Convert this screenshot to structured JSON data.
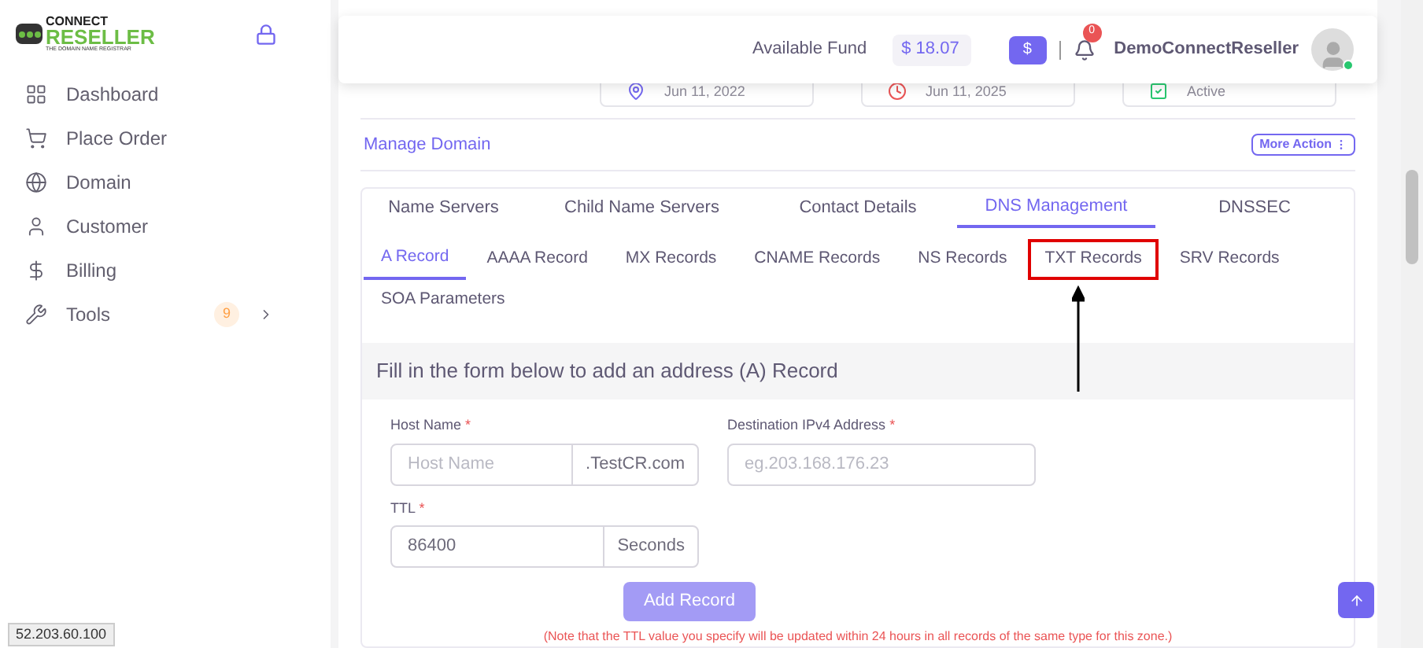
{
  "sidebar": {
    "logo": {
      "line1": "CONNECT",
      "line2": "RESELLER",
      "tagline": "THE DOMAIN NAME REGISTRAR"
    },
    "items": [
      {
        "label": "Dashboard"
      },
      {
        "label": "Place Order"
      },
      {
        "label": "Domain"
      },
      {
        "label": "Customer"
      },
      {
        "label": "Billing"
      },
      {
        "label": "Tools",
        "badge": "9"
      }
    ]
  },
  "header": {
    "fund_label": "Available Fund",
    "fund_value": "$ 18.07",
    "add_fund": "$",
    "notifications": "0",
    "user": "DemoConnectReseller",
    "online": true
  },
  "summary_cards": [
    {
      "kind": "pin",
      "text": "Jun 11, 2022"
    },
    {
      "kind": "clock",
      "text": "Jun 11, 2025"
    },
    {
      "kind": "check",
      "text": "Active"
    }
  ],
  "manage": {
    "title": "Manage Domain",
    "action": "More Action"
  },
  "main_tabs": [
    {
      "label": "Name Servers",
      "selected": false
    },
    {
      "label": "Child Name Servers",
      "selected": false
    },
    {
      "label": "Contact Details",
      "selected": false
    },
    {
      "label": "DNS Management",
      "selected": true
    },
    {
      "label": "DNSSEC",
      "selected": false
    }
  ],
  "record_tabs": [
    {
      "label": "A Record",
      "selected": true,
      "highlighted": false
    },
    {
      "label": "AAAA Record",
      "selected": false,
      "highlighted": false
    },
    {
      "label": "MX Records",
      "selected": false,
      "highlighted": false
    },
    {
      "label": "CNAME Records",
      "selected": false,
      "highlighted": false
    },
    {
      "label": "NS Records",
      "selected": false,
      "highlighted": false
    },
    {
      "label": "TXT Records",
      "selected": false,
      "highlighted": true
    },
    {
      "label": "SRV Records",
      "selected": false,
      "highlighted": false
    },
    {
      "label": "SOA Parameters",
      "selected": false,
      "highlighted": false
    }
  ],
  "form": {
    "title": "Fill in the form below to add an address (A) Record",
    "host": {
      "label": "Host Name",
      "required": "*",
      "placeholder": "Host Name",
      "suffix": ".TestCR.com"
    },
    "ipv4": {
      "label": "Destination IPv4 Address",
      "required": "*",
      "placeholder": "eg.203.168.176.23"
    },
    "ttl": {
      "label": "TTL",
      "required": "*",
      "value": "86400",
      "suffix": "Seconds"
    },
    "submit": "Add Record",
    "note": "(Note that the TTL value you specify will be updated within 24 hours in all records of the same type for this zone.)"
  },
  "status_ip": "52.203.60.100"
}
